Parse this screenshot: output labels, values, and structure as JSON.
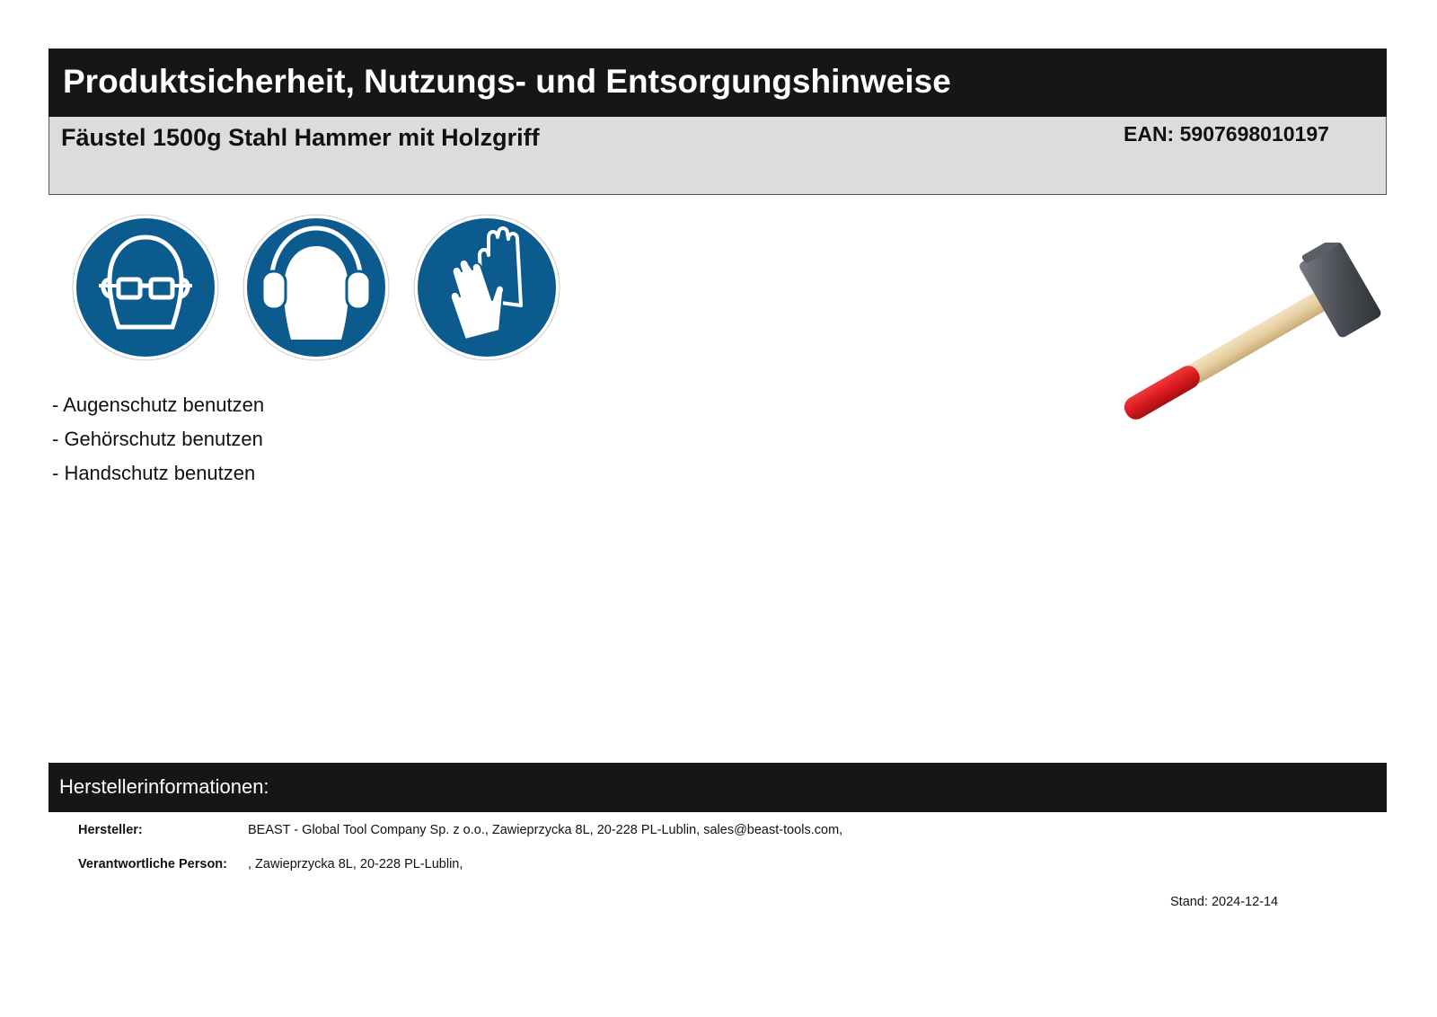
{
  "header": {
    "title": "Produktsicherheit, Nutzungs- und Entsorgungshinweise",
    "product_name": "Fäustel 1500g Stahl Hammer mit Holzgriff",
    "ean": "EAN: 5907698010197"
  },
  "safety_signs": [
    {
      "icon": "eye-protection-icon"
    },
    {
      "icon": "hearing-protection-icon"
    },
    {
      "icon": "hand-protection-icon"
    }
  ],
  "colors": {
    "sign_blue": "#0c5b8f",
    "bar_black": "#161616",
    "product_bar_gray": "#dcdcdc",
    "handle_red": "#d81a1f"
  },
  "instructions": [
    "- Augenschutz benutzen",
    "- Gehörschutz benutzen",
    "- Handschutz benutzen"
  ],
  "manufacturer": {
    "section_title": "Herstellerinformationen:",
    "rows": [
      {
        "label": "Hersteller:",
        "value": "BEAST - Global Tool Company Sp. z o.o., Zawieprzycka 8L, 20-228 PL-Lublin, sales@beast-tools.com,"
      },
      {
        "label": "Verantwortliche Person:",
        "value": ", Zawieprzycka 8L, 20-228 PL-Lublin,"
      }
    ]
  },
  "footer": {
    "stand": "Stand: 2024-12-14"
  }
}
